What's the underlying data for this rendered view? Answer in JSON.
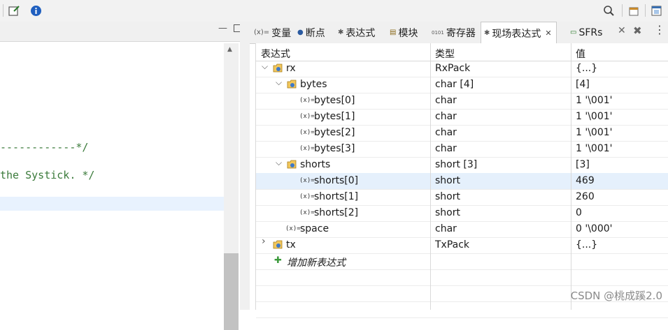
{
  "toolbar": {
    "icons": [
      "toolbar-sep",
      "new-item-icon",
      "info-icon",
      "zoom-icon",
      "perspective-icon",
      "window-icon"
    ]
  },
  "editor": {
    "lines": [
      {
        "text": "------------*/"
      },
      {
        "text": "the Systick. */"
      }
    ]
  },
  "views": {
    "tabs": [
      {
        "icon": "(x)=",
        "label": "变量"
      },
      {
        "icon": "●",
        "label": "断点"
      },
      {
        "icon": "✱",
        "label": "表达式"
      },
      {
        "icon": "▤",
        "label": "模块"
      },
      {
        "icon": "0101",
        "label": "寄存器"
      },
      {
        "icon": "✱",
        "label": "现场表达式"
      },
      {
        "icon": "▭",
        "label": "SFRs"
      }
    ],
    "close_glyph": "✕"
  },
  "table": {
    "headers": [
      "表达式",
      "类型",
      "值"
    ],
    "rows": [
      {
        "expr": "rx",
        "type": "RxPack",
        "value": "{...}",
        "indent": 0,
        "twist": "open",
        "icon": "struct"
      },
      {
        "expr": "bytes",
        "type": "char [4]",
        "value": "[4]",
        "indent": 1,
        "twist": "open",
        "icon": "struct"
      },
      {
        "expr": "bytes[0]",
        "type": "char",
        "value": "1 '\\001'",
        "indent": 2,
        "twist": "none",
        "icon": "var"
      },
      {
        "expr": "bytes[1]",
        "type": "char",
        "value": "1 '\\001'",
        "indent": 2,
        "twist": "none",
        "icon": "var"
      },
      {
        "expr": "bytes[2]",
        "type": "char",
        "value": "1 '\\001'",
        "indent": 2,
        "twist": "none",
        "icon": "var"
      },
      {
        "expr": "bytes[3]",
        "type": "char",
        "value": "1 '\\001'",
        "indent": 2,
        "twist": "none",
        "icon": "var"
      },
      {
        "expr": "shorts",
        "type": "short [3]",
        "value": "[3]",
        "indent": 1,
        "twist": "open",
        "icon": "struct"
      },
      {
        "expr": "shorts[0]",
        "type": "short",
        "value": "469",
        "indent": 2,
        "twist": "none",
        "icon": "var",
        "selected": true
      },
      {
        "expr": "shorts[1]",
        "type": "short",
        "value": "260",
        "indent": 2,
        "twist": "none",
        "icon": "var"
      },
      {
        "expr": "shorts[2]",
        "type": "short",
        "value": "0",
        "indent": 2,
        "twist": "none",
        "icon": "var"
      },
      {
        "expr": "space",
        "type": "char",
        "value": "0 '\\000'",
        "indent": 1,
        "twist": "none",
        "icon": "var"
      },
      {
        "expr": "tx",
        "type": "TxPack",
        "value": "{...}",
        "indent": 0,
        "twist": "closed",
        "icon": "struct"
      }
    ],
    "add_label": "增加新表达式",
    "var_glyph": "(x)="
  },
  "watermark": "CSDN @桃成蹊2.0"
}
